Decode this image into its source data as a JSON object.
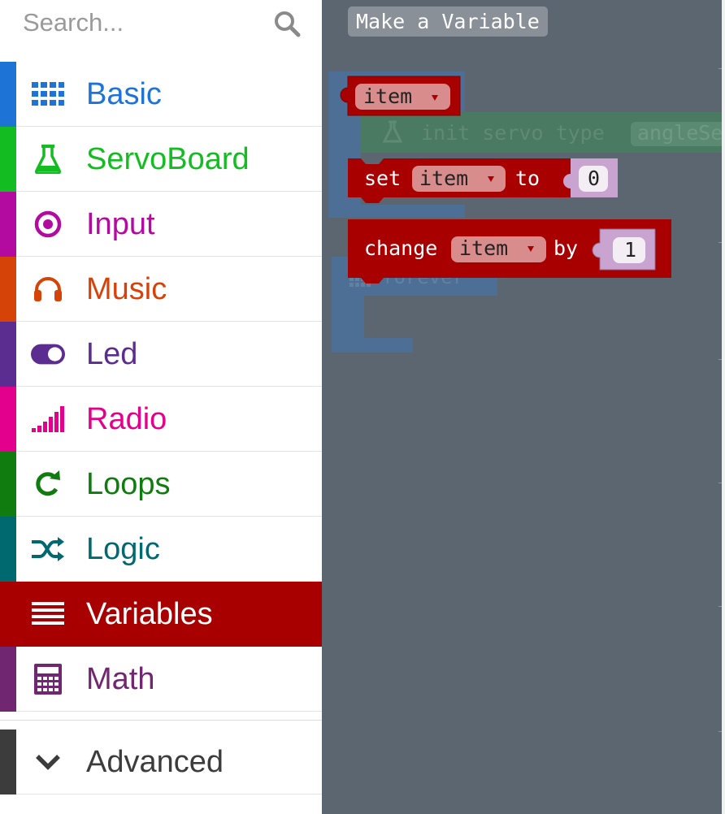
{
  "search": {
    "placeholder": "Search..."
  },
  "categories": [
    {
      "label": "Basic",
      "icon": "grid-icon",
      "color": "#1e74d6"
    },
    {
      "label": "ServoBoard",
      "icon": "flask-icon",
      "color": "#13bd21"
    },
    {
      "label": "Input",
      "icon": "target-icon",
      "color": "#b30b9f"
    },
    {
      "label": "Music",
      "icon": "headphones-icon",
      "color": "#d64309"
    },
    {
      "label": "Led",
      "icon": "toggle-icon",
      "color": "#5c2d91"
    },
    {
      "label": "Radio",
      "icon": "signal-bars-icon",
      "color": "#e3008c"
    },
    {
      "label": "Loops",
      "icon": "refresh-icon",
      "color": "#107c10"
    },
    {
      "label": "Logic",
      "icon": "shuffle-icon",
      "color": "#006970"
    },
    {
      "label": "Variables",
      "icon": "list-lines-icon",
      "color": "#a80000",
      "selected": true
    },
    {
      "label": "Math",
      "icon": "calculator-icon",
      "color": "#712672"
    }
  ],
  "advanced": {
    "label": "Advanced",
    "icon": "chevron-down-icon",
    "color": "#3c3c3c"
  },
  "workspace": {
    "make_variable_label": "Make a Variable",
    "item_block": {
      "variable": "item"
    },
    "set_block": {
      "keyword": "set",
      "variable": "item",
      "to": "to",
      "value": "0"
    },
    "change_block": {
      "keyword": "change",
      "variable": "item",
      "by": "by",
      "value": "1"
    },
    "background_blocks": {
      "init_servo": {
        "text": "init servo type",
        "param": "angleSe"
      },
      "forever": "forever"
    }
  },
  "colors": {
    "workspace_bg": "#5c6670",
    "variables_block": "#a80000",
    "number_slot": "#c9a4d0"
  }
}
